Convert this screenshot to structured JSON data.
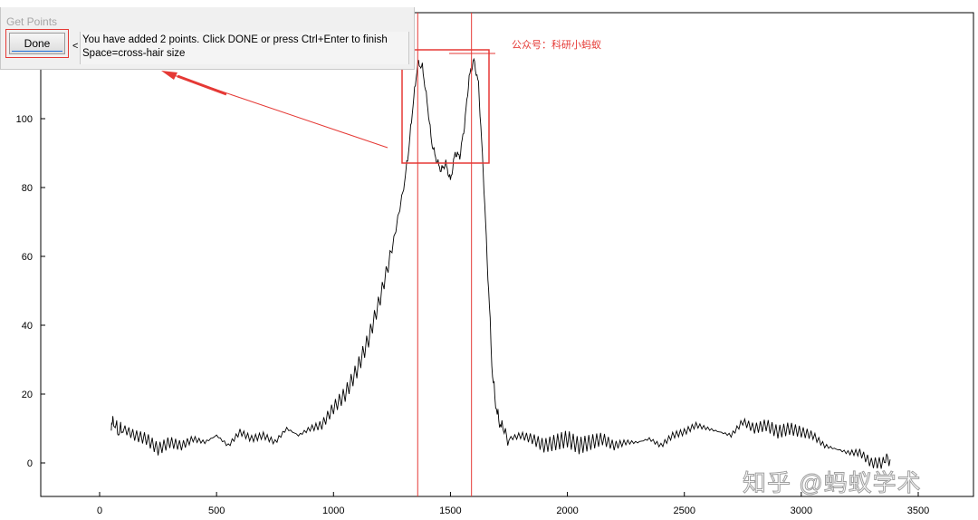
{
  "dialog": {
    "title": "Get Points",
    "done_label": "Done",
    "lt": "<",
    "message_line1": "You have added 2 points. Click DONE or press Ctrl+Enter to finish",
    "message_line2": "Space=cross-hair size"
  },
  "watermark_text": "公众号：科研小蚂蚁",
  "zhihu_text": "知乎 @蚂蚁学术",
  "colors": {
    "trace": "#000000",
    "annotation": "#e53935",
    "dialog_bg": "#f0f0f0"
  },
  "chart_data": {
    "type": "line",
    "title": "",
    "xlabel": "",
    "ylabel": "",
    "xlim": [
      -250,
      3720
    ],
    "ylim": [
      -10,
      130
    ],
    "xticks": [
      0,
      500,
      1000,
      1500,
      2000,
      2500,
      3000,
      3500
    ],
    "yticks": [
      0,
      20,
      40,
      60,
      80,
      100
    ],
    "grid": false,
    "series": [
      {
        "x": [
          50,
          60,
          80,
          100,
          150,
          200,
          250,
          300,
          350,
          400,
          450,
          500,
          550,
          600,
          650,
          700,
          750,
          800,
          850,
          900,
          950,
          1000,
          1050,
          1100,
          1150,
          1200,
          1250,
          1300,
          1320,
          1340,
          1360,
          1380,
          1400,
          1420,
          1440,
          1460,
          1480,
          1500,
          1520,
          1540,
          1560,
          1580,
          1600,
          1620,
          1640,
          1660,
          1680,
          1700,
          1720,
          1750,
          1800,
          1850,
          1900,
          1950,
          2000,
          2050,
          2100,
          2150,
          2200,
          2250,
          2300,
          2350,
          2400,
          2450,
          2500,
          2550,
          2600,
          2650,
          2700,
          2750,
          2800,
          2850,
          2900,
          2950,
          3000,
          3050,
          3100,
          3150,
          3200,
          3250,
          3300,
          3350,
          3380
        ],
        "y": [
          10,
          12,
          9,
          10,
          8,
          7,
          4,
          6,
          5,
          7,
          6,
          8,
          5,
          9,
          7,
          8,
          6,
          10,
          8,
          10,
          11,
          16,
          20,
          27,
          36,
          48,
          62,
          80,
          90,
          104,
          116,
          115,
          105,
          93,
          88,
          85,
          87,
          82,
          90,
          89,
          98,
          112,
          117,
          110,
          85,
          55,
          25,
          14,
          10,
          7,
          8,
          7,
          5,
          6,
          7,
          5,
          6,
          7,
          5,
          6,
          6,
          7,
          5,
          8,
          9,
          11,
          10,
          9,
          8,
          12,
          10,
          11,
          9,
          10,
          9,
          8,
          5,
          4,
          3,
          3,
          0,
          0,
          1
        ]
      }
    ],
    "vertical_markers_x": [
      1360,
      1590
    ]
  }
}
